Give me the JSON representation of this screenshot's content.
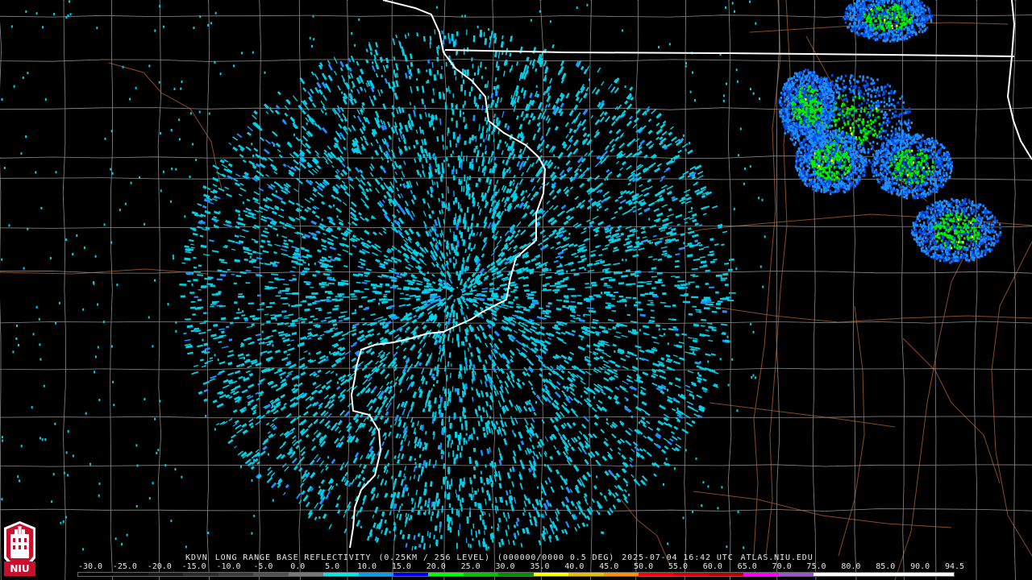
{
  "product": {
    "station": "KDVN",
    "product_name": "LONG RANGE BASE REFLECTIVITY",
    "resolution": "(0.25KM / 256 LEVEL)",
    "volume": "(000000/0000 0.5 DEG)",
    "timestamp": "2025-07-04 16:42 UTC",
    "source": "ATLAS.NIU.EDU"
  },
  "color_scale": {
    "labels": [
      "-30.0",
      "-25.0",
      "-20.0",
      "-15.0",
      "-10.0",
      "-5.0",
      "0.0",
      "5.0",
      "10.0",
      "15.0",
      "20.0",
      "25.0",
      "30.0",
      "35.0",
      "40.0",
      "45.0",
      "50.0",
      "55.0",
      "60.0",
      "65.0",
      "70.0",
      "75.0",
      "80.0",
      "85.0",
      "90.0",
      "94.5"
    ],
    "colors": [
      "#000000",
      "#0c0c0c",
      "#1a1a1a",
      "#2b2b2b",
      "#3a3a3a",
      "#505050",
      "#787878",
      "#00e8e8",
      "#00a0f5",
      "#0000f5",
      "#00ff00",
      "#00c800",
      "#009000",
      "#ffff00",
      "#e7c000",
      "#ff9000",
      "#ff0000",
      "#d60000",
      "#c00000",
      "#ff00ff",
      "#9955c9",
      "#ffffff",
      "#ffffff",
      "#ffffff",
      "#ffffff"
    ]
  },
  "logo": {
    "text": "NIU",
    "colors": {
      "primary": "#c8102e",
      "secondary": "#ffffff"
    }
  },
  "map": {
    "radar_site_color": "#000000",
    "echo_colors": {
      "weak": "#00d0e8",
      "light": "#1e90ff",
      "moderate": "#0050f0",
      "green": "#00ee00",
      "yellow": "#ffff00"
    },
    "boundary_colors": {
      "state": "#ffffff",
      "county": "#8a8a8a",
      "road": "#8a4a22"
    }
  }
}
